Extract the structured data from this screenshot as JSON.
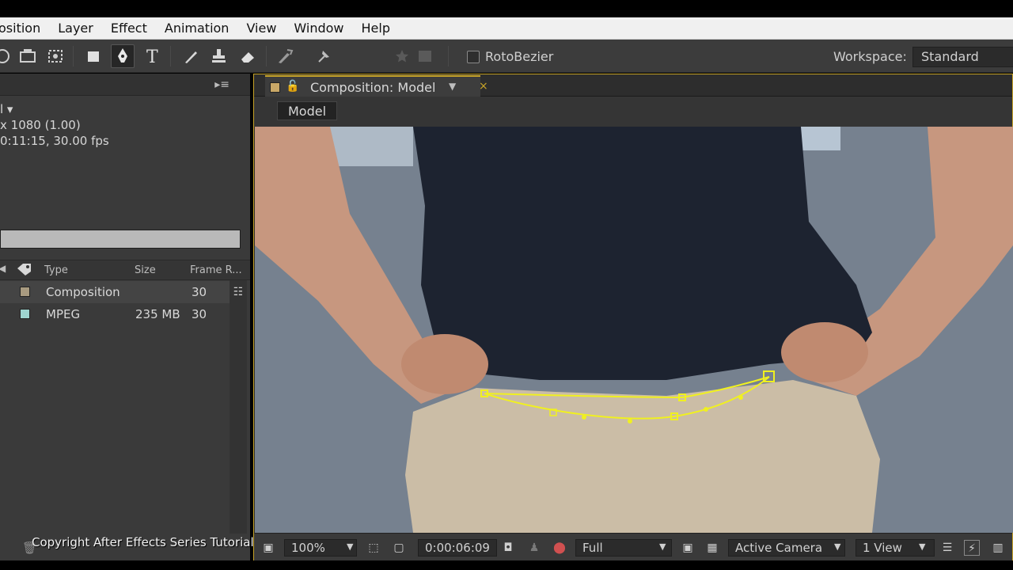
{
  "menubar": {
    "items": [
      "osition",
      "Layer",
      "Effect",
      "Animation",
      "View",
      "Window",
      "Help"
    ]
  },
  "toolbar": {
    "rotobezier_label": "RotoBezier",
    "rotobezier_checked": false,
    "workspace_label": "Workspace:",
    "workspace_value": "Standard"
  },
  "project": {
    "item_name_fragment": "l ▾",
    "info_line1": "x 1080 (1.00)",
    "info_line2": "0:11:15, 30.00 fps",
    "columns": {
      "type": "Type",
      "size": "Size",
      "frame_rate": "Frame R..."
    },
    "rows": [
      {
        "type": "Composition",
        "size": "",
        "frame_rate": "30",
        "label_color": "#a89a80"
      },
      {
        "type": "MPEG",
        "size": "235 MB",
        "frame_rate": "30",
        "label_color": "#9ed4cf"
      }
    ]
  },
  "composition": {
    "tab_title": "Composition: Model",
    "breadcrumb": "Model",
    "accent_color": "#c8a428",
    "mask_color": "#f0f020"
  },
  "viewer_footer": {
    "zoom": "100%",
    "timecode": "0:00:06:09",
    "resolution": "Full",
    "camera": "Active Camera",
    "views": "1 View"
  },
  "watermark": "Copyright After Effects Series Tutorials"
}
